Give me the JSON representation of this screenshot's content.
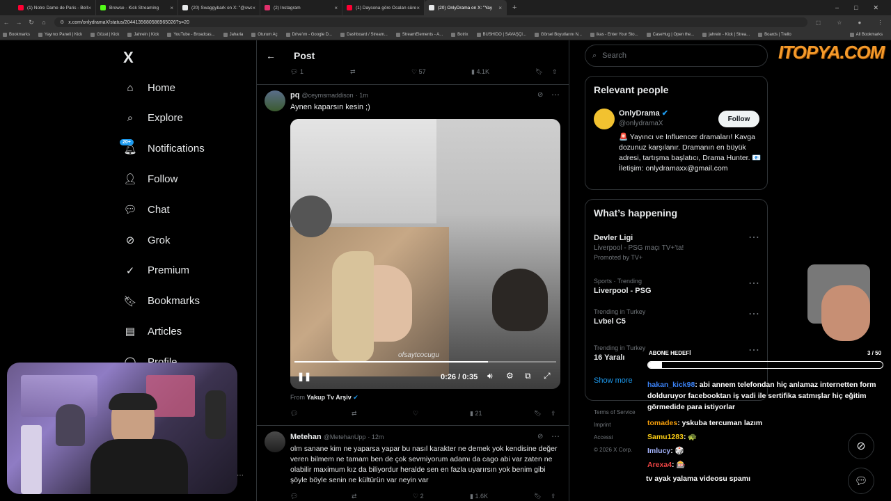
{
  "tabs": [
    {
      "label": "(1) Notre Dame de Paris - Belle",
      "color": "#ff0033"
    },
    {
      "label": "Browse - Kick Streaming",
      "color": "#53fc18"
    },
    {
      "label": "(20) Swaggybark on X: \"@swag",
      "color": "#e7e9ea"
    },
    {
      "label": "(2) Instagram",
      "color": "#e1306c"
    },
    {
      "label": "(1) Daysona göre Öcalan süreci",
      "color": "#ff0033"
    },
    {
      "label": "(20) OnlyDrama on X: \"Yay",
      "color": "#e7e9ea"
    }
  ],
  "url": "x.com/onlydramaX/status/2044135680586965026?s=20",
  "bookmarks": [
    "Bookmarks",
    "Yayıncı Paneli | Kick",
    "Gözat | Kick",
    "Jahrein | Kick",
    "YouTube - Broadcas...",
    "Jaharia",
    "Oturum Aç",
    "Drive'ım - Google D...",
    "Dashboard / Stream...",
    "StreamElements - A...",
    "Botrix",
    "BUSHIDO | SAVAŞÇI...",
    "Görsel Boyutlarını N...",
    "ikas - Enter Your Sto...",
    "CaseHug | Open the...",
    "jahrein - Kick | Strea...",
    "Boards | Trello",
    "All Bookmarks"
  ],
  "nav": {
    "logo": "X",
    "items": [
      "Home",
      "Explore",
      "Notifications",
      "Follow",
      "Chat",
      "Grok",
      "Premium",
      "Bookmarks",
      "Articles",
      "Profile"
    ],
    "badge": "20+"
  },
  "header": {
    "title": "Post"
  },
  "top_stats": {
    "replies": "1",
    "likes": "57",
    "views": "4.1K"
  },
  "tweet1": {
    "name": "pq",
    "handle": "@ceymsmaddison",
    "time": "· 1m",
    "text": "Aynen kaparsın kesin ;)",
    "video_time": "0:26 / 0:35",
    "watermark": "ofsaytcocugu",
    "from_label": "From",
    "from_source": "Yakup Tv Arşiv",
    "views": "21",
    "progress": 0.74
  },
  "tweet2": {
    "name": "Metehan",
    "handle": "@MetehanUpp",
    "time": "· 12m",
    "text": "olm sanane kim ne yaparsa yapar bu nasıl karakter ne demek yok kendisine değer veren bilmem ne tamam ben de çok sevmiyorum adamı da cago abi var zaten ne olabilir maximum kız da biliyordur heralde sen en fazla uyarırsın yok benim gibi şöyle böyle senin ne kültürün var neyin var",
    "likes": "2",
    "views": "1.6K"
  },
  "search": {
    "placeholder": "Search"
  },
  "relevant": {
    "title": "Relevant people",
    "name": "OnlyDrama",
    "handle": "@onlydramaX",
    "follow": "Follow",
    "bio": "🚨 Yayıncı ve Influencer dramaları! Kavga dozunuz karşılanır. Dramanın en büyük adresi, tartışma başlatıcı, Drama Hunter. 📧 İletişim: onlydramaxx@gmail.com"
  },
  "happening": {
    "title": "What’s happening",
    "trends": [
      {
        "kicker": "Devler Ligi",
        "value": "Liverpool - PSG maçı TV+'ta!",
        "promo": "Promoted by TV+"
      },
      {
        "kicker": "Sports · Trending",
        "value": "Liverpool - PSG"
      },
      {
        "kicker": "Trending in Turkey",
        "value": "Lvbel C5"
      },
      {
        "kicker": "Trending in Turkey",
        "value": "16 Yaralı"
      }
    ],
    "show_more": "Show more"
  },
  "footer": [
    "Terms of Service",
    "Imprint",
    "Accessi",
    "© 2026 X Corp."
  ],
  "overlay": {
    "logo": "ITOPYA.COM",
    "goal_label": "ABONE HEDEFİ",
    "goal_count": "3 / 50",
    "goal_progress": 0.06,
    "chat": [
      {
        "user": "hakan_kick98",
        "color": "#3b82f6",
        "msg": ": abi annem telefondan hiç anlamaz internetten form dolduruyor facebooktan iş vadi ile sertifika satmışlar hiç eğitim görmedide para istiyorlar"
      },
      {
        "user": "tomades",
        "color": "#f59e0b",
        "msg": ": yskuba tercuman lazım"
      },
      {
        "user": "Samu1283",
        "color": "#facc15",
        "msg": ": 🐢"
      },
      {
        "user": "Imlucy",
        "color": "#a5b4fc",
        "msg": ": 🎲"
      },
      {
        "user": "Arexa4",
        "color": "#ef4444",
        "msg": ": 🎰"
      }
    ],
    "last_line": "tv ayak yalama videosu spamı"
  }
}
